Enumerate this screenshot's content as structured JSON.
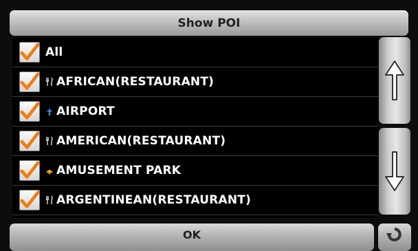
{
  "title": "Show POI",
  "items": [
    {
      "label": "All",
      "checked": true,
      "icon": "none"
    },
    {
      "label": "AFRICAN(RESTAURANT)",
      "checked": true,
      "icon": "fork-knife-icon"
    },
    {
      "label": "AIRPORT",
      "checked": true,
      "icon": "airplane-icon"
    },
    {
      "label": "AMERICAN(RESTAURANT)",
      "checked": true,
      "icon": "fork-knife-icon"
    },
    {
      "label": "AMUSEMENT PARK",
      "checked": true,
      "icon": "amusement-park-icon"
    },
    {
      "label": "ARGENTINEAN(RESTAURANT)",
      "checked": true,
      "icon": "fork-knife-icon"
    }
  ],
  "buttons": {
    "ok_label": "OK",
    "scroll_up_icon": "arrow-up-icon",
    "scroll_down_icon": "arrow-down-icon",
    "back_icon": "back-icon"
  },
  "colors": {
    "checkmark": "#f07c12",
    "airport_icon": "#3b8fe8",
    "amusement_icon": "#f0a11a"
  }
}
